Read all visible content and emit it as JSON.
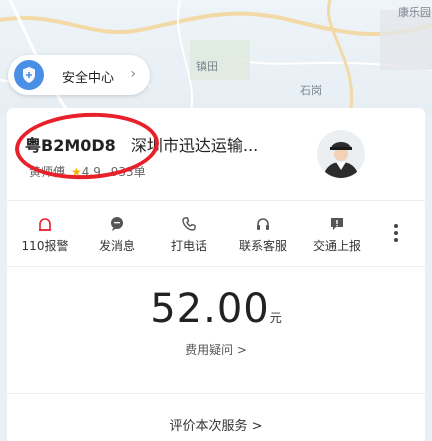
{
  "map": {
    "labels": [
      "康乐园",
      "镇田",
      "石岗"
    ]
  },
  "safety_center": {
    "label": "安全中心",
    "chevron": "›"
  },
  "trip": {
    "plate": "粤B2M0D8",
    "company": "深圳市迅达运输...",
    "driver_name": "黄师傅",
    "star": "★",
    "rating": "4.9",
    "orders": "933单"
  },
  "actions": [
    {
      "label": "110报警",
      "icon": "alarm-icon"
    },
    {
      "label": "发消息",
      "icon": "message-icon"
    },
    {
      "label": "打电话",
      "icon": "phone-icon"
    },
    {
      "label": "联系客服",
      "icon": "headset-icon"
    },
    {
      "label": "交通上报",
      "icon": "report-icon"
    }
  ],
  "fare": {
    "amount": "52.00",
    "unit": "元",
    "question": "费用疑问 >"
  },
  "rate_trip": "评价本次服务 >",
  "colors": {
    "accent": "#4a8fe6",
    "annotation": "#e8202a",
    "star": "#f5b301"
  }
}
